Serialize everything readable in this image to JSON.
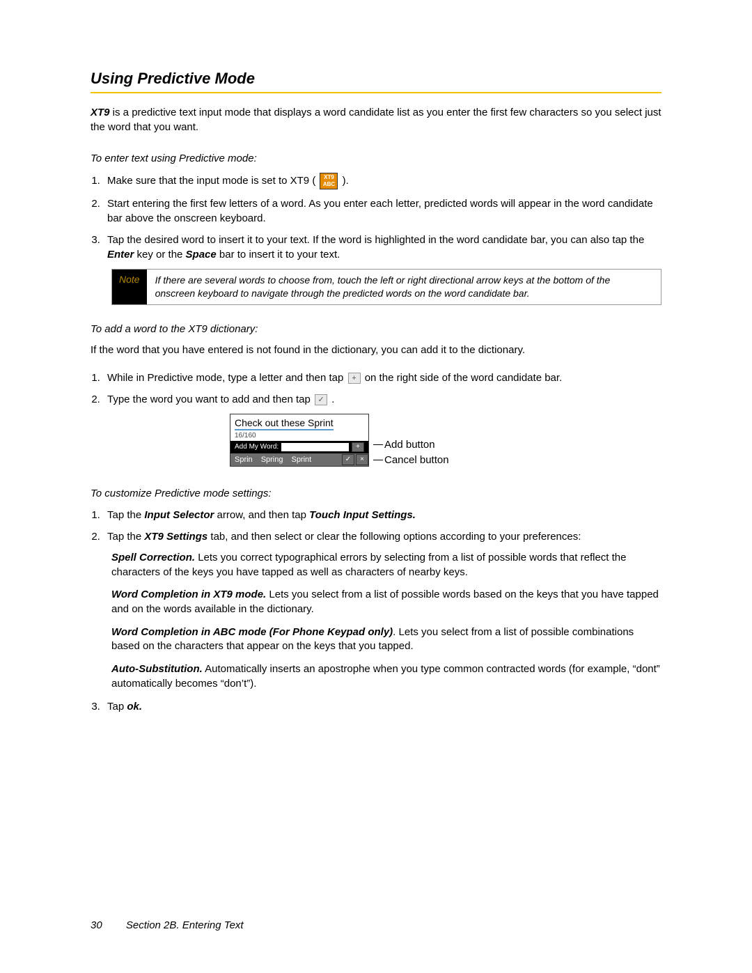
{
  "heading": "Using Predictive Mode",
  "intro": {
    "boldLead": "XT9",
    "rest": " is a predictive text input mode that displays a word candidate list as you enter the first few characters so you select just the word that you want."
  },
  "sec1": {
    "title": "To enter text using Predictive mode:",
    "step1a": "Make sure that the input mode is set to XT9 ( ",
    "step1b": " ).",
    "xt9IconTop": "XT9",
    "xt9IconBottom": "ABC",
    "step2": "Start entering the first few letters of a word. As you enter each letter, predicted words will appear in the word candidate bar above the onscreen keyboard.",
    "step3a": "Tap the desired word to insert it to your text. If the word is highlighted in the word candidate bar, you can also tap the ",
    "step3enter": "Enter",
    "step3mid": " key or the ",
    "step3space": "Space",
    "step3b": " bar to insert it to your text."
  },
  "note": {
    "label": "Note",
    "text": "If there are several words to choose from, touch the left or right directional arrow keys at the bottom of the onscreen keyboard to navigate through the predicted words on the word candidate bar."
  },
  "sec2": {
    "title": "To add a word to the XT9 dictionary:",
    "intro": "If the word that you have entered is not found in the dictionary, you can add it to the dictionary.",
    "step1a": "While in Predictive mode, type a letter and then tap ",
    "plus": "+",
    "step1b": " on the right side of the word candidate bar.",
    "step2a": "Type the word you want to add and then tap ",
    "check": "✓",
    "step2b": "."
  },
  "mock": {
    "typed": "Check out these Sprint",
    "count": "16/160",
    "addLabel": "Add My Word:",
    "cand1": "Sprin",
    "cand2": "Spring",
    "cand3": "Sprint",
    "candCheck": "✓",
    "candX": "×",
    "callAdd": "Add button",
    "callCancel": "Cancel button"
  },
  "sec3": {
    "title": "To customize Predictive mode settings:",
    "step1a": "Tap the ",
    "step1b": "Input Selector",
    "step1c": " arrow, and then tap ",
    "step1d": "Touch Input Settings.",
    "step2a": "Tap the ",
    "step2b": "XT9 Settings",
    "step2c": " tab, and then select or clear the following options according to your preferences:",
    "opts": {
      "o1h": "Spell Correction.",
      "o1t": " Lets you correct typographical errors by selecting from a list of possible words that reflect the characters of the keys you have tapped as well as characters of nearby keys.",
      "o2h": "Word Completion in XT9 mode.",
      "o2t": " Lets you select from a list of possible words based on the keys that you have tapped and on the words available in the dictionary.",
      "o3h": "Word Completion in ABC mode (For Phone Keypad only)",
      "o3t": ". Lets you select from a list of possible combinations based on the characters that appear on the keys that you tapped.",
      "o4h": "Auto-Substitution.",
      "o4t": " Automatically inserts an apostrophe when you type common contracted words (for example, “dont” automatically becomes “don’t”)."
    },
    "step3a": "Tap ",
    "step3b": "ok."
  },
  "footer": {
    "page": "30",
    "section": "Section 2B. Entering Text"
  }
}
